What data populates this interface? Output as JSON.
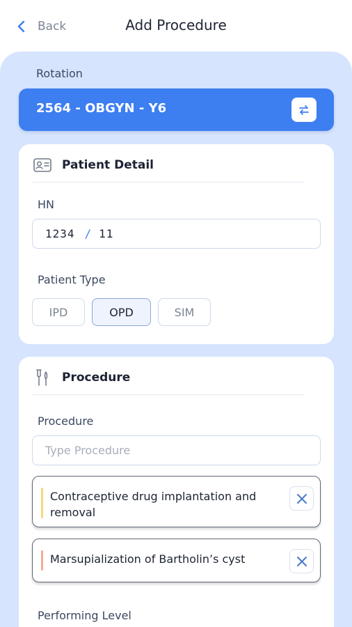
{
  "header": {
    "back_label": "Back",
    "title": "Add Procedure"
  },
  "rotation": {
    "label": "Rotation",
    "value": "2564 - OBGYN - Y6",
    "swap_icon": "swap-icon"
  },
  "patient_detail": {
    "title": "Patient Detail",
    "icon": "id-card-icon",
    "hn_label": "HN",
    "hn_part1": "1234",
    "hn_separator": "/",
    "hn_part2": "11",
    "patient_type_label": "Patient Type",
    "patient_types": [
      "IPD",
      "OPD",
      "SIM"
    ],
    "selected_type": "OPD"
  },
  "procedure": {
    "title": "Procedure",
    "icon": "medical-tools-icon",
    "field_label": "Procedure",
    "placeholder": "Type Procedure",
    "items": [
      {
        "text": "Contraceptive drug implantation and removal",
        "accent": "#f5d97a"
      },
      {
        "text": "Marsupialization of Bartholin’s cyst",
        "accent": "#f4ab8e"
      }
    ],
    "performing_level_label": "Performing Level"
  },
  "colors": {
    "accent": "#3d7ef0",
    "panel_background": "#d6e4fd"
  }
}
